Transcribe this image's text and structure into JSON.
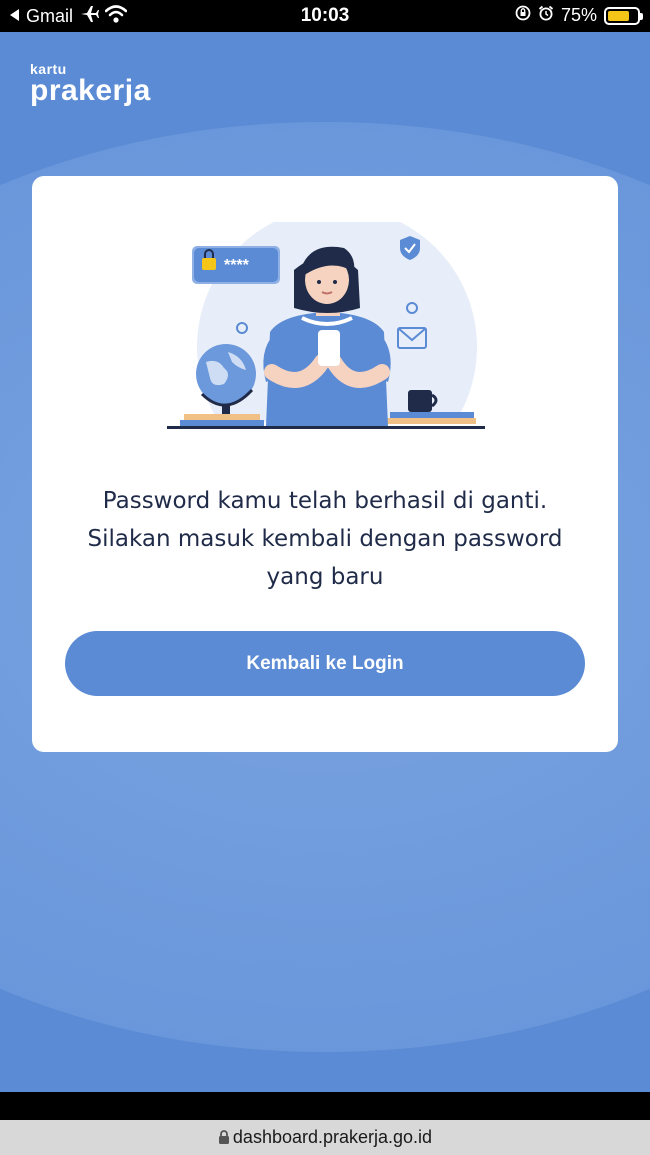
{
  "status_bar": {
    "back_app": "Gmail",
    "time": "10:03",
    "battery_percent": "75%",
    "battery_level": 0.75
  },
  "logo": {
    "small": "kartu",
    "main": "prakerja"
  },
  "card": {
    "message_line1": "Password kamu telah berhasil di ganti.",
    "message_line2": "Silakan masuk kembali dengan password",
    "message_line3": "yang baru",
    "button_label": "Kembali ke Login",
    "password_mask": "****"
  },
  "browser": {
    "url": "dashboard.prakerja.go.id"
  },
  "colors": {
    "primary": "#5b8bd4",
    "text": "#1f2b48",
    "battery": "#f5c518"
  },
  "icons": [
    "back-arrow-icon",
    "airplane-icon",
    "wifi-icon",
    "orientation-lock-icon",
    "alarm-icon",
    "battery-icon",
    "lock-icon"
  ]
}
